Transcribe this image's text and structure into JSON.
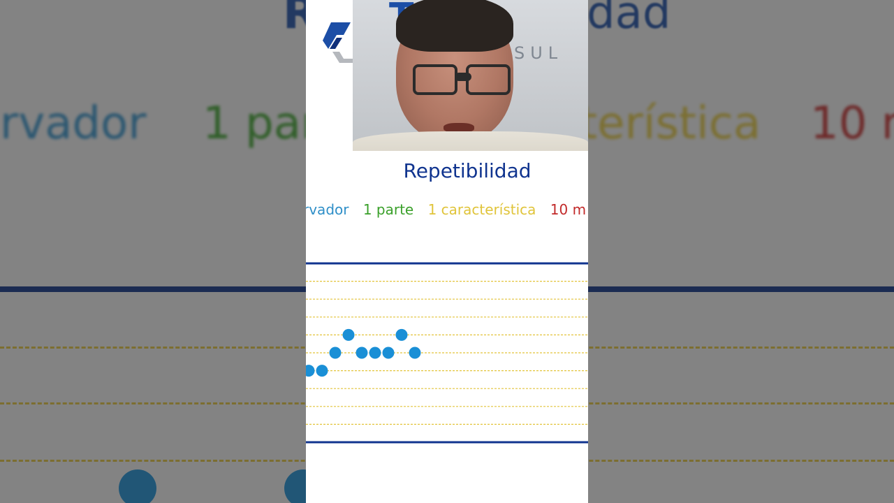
{
  "title": "Repetibilidad",
  "labels": [
    {
      "text": "rvador",
      "color": "#2f8fc8"
    },
    {
      "text": "1 parte",
      "color": "#3aa02a"
    },
    {
      "text": "1 característica",
      "color": "#e0c43a"
    },
    {
      "text": "10 m",
      "color": "#c22a2a"
    }
  ],
  "video": {
    "brand_text": "Too",
    "sub_text": "NSUL"
  },
  "background": {
    "words": [
      {
        "text": "rvador",
        "color": "#2f8fc8"
      },
      {
        "text": "1 par",
        "color": "#3aa02a"
      },
      {
        "text": "terística",
        "color": "#e0c43a"
      },
      {
        "text": "10 m",
        "color": "#c22a2a"
      }
    ],
    "brand_left": "R",
    "brand_right": "dad"
  },
  "colors": {
    "accent_blue": "#10348f",
    "dot_blue": "#1a8fd6",
    "grid_yellow": "#e3c43a"
  },
  "chart_data": {
    "type": "scatter",
    "title": "",
    "xlabel": "",
    "ylabel": "",
    "grid": true,
    "x": [
      1,
      2,
      3,
      4,
      5,
      6,
      7,
      8,
      9
    ],
    "y": [
      4,
      4,
      5,
      6,
      5,
      5,
      5,
      6,
      5
    ],
    "ylim": [
      0,
      10
    ],
    "xlim": [
      1,
      23
    ]
  }
}
